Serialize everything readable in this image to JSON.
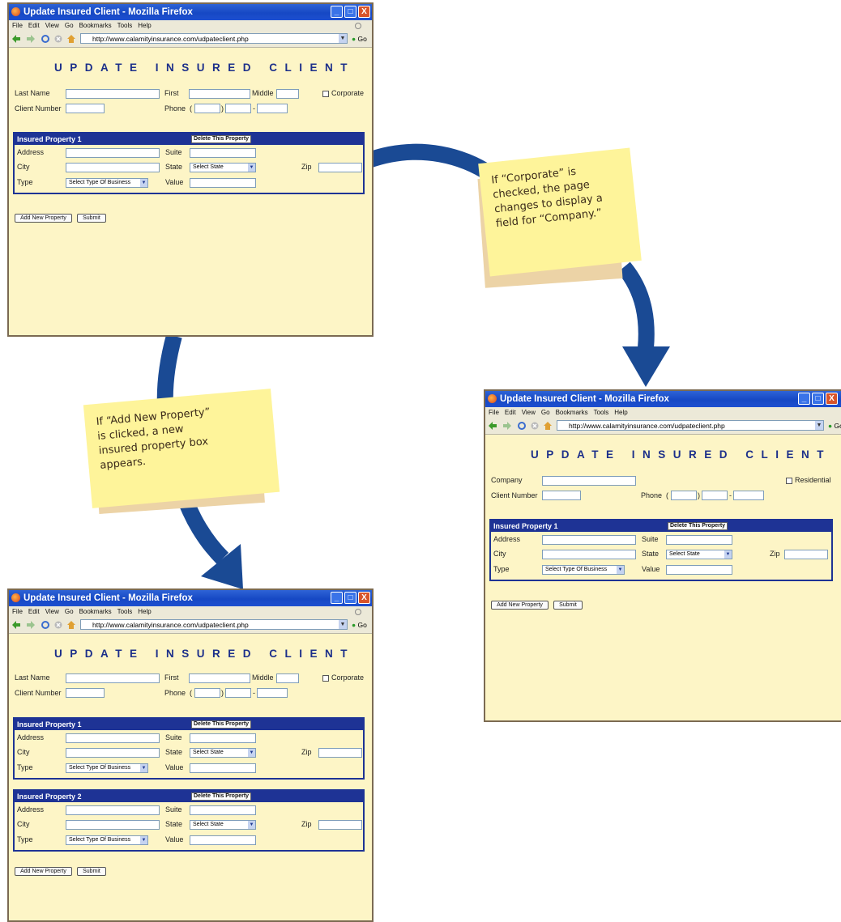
{
  "browser": {
    "title": "Update Insured Client - Mozilla Firefox",
    "menu": [
      "File",
      "Edit",
      "View",
      "Go",
      "Bookmarks",
      "Tools",
      "Help"
    ],
    "url": "http://www.calamityinsurance.com/udpateclient.php",
    "go_label": "Go",
    "min_symbol": "_",
    "max_symbol": "□",
    "close_symbol": "X"
  },
  "form": {
    "heading": "UPDATE INSURED CLIENT",
    "last_name_label": "Last Name",
    "first_label": "First",
    "middle_label": "Middle",
    "corporate_label": "Corporate",
    "company_label": "Company",
    "residential_label": "Residential",
    "client_number_label": "Client Number",
    "phone_label": "Phone",
    "phone_open": "(",
    "phone_close": ")",
    "phone_dash": "-",
    "add_property_button": "Add New Property",
    "submit_button": "Submit"
  },
  "property": {
    "title_1": "Insured Property 1",
    "title_2": "Insured Property 2",
    "delete_button": "Delete This Property",
    "address_label": "Address",
    "suite_label": "Suite",
    "city_label": "City",
    "state_label": "State",
    "zip_label": "Zip",
    "type_label": "Type",
    "value_label": "Value",
    "state_select": "Select State",
    "type_select": "Select Type Of Business"
  },
  "notes": {
    "corporate_line1": "If “Corporate” is",
    "corporate_line2": "checked, the page",
    "corporate_line3": "changes to display a",
    "corporate_line4": "field for “Company.”",
    "add_line1": "If “Add New Property”",
    "add_line2": "is clicked, a new",
    "add_line3": "insured property box",
    "add_line4": "appears."
  },
  "colors": {
    "page_bg": "#fdf5c6",
    "accent": "#1e3395",
    "arrow": "#1a4a94",
    "note": "#fef49a"
  }
}
